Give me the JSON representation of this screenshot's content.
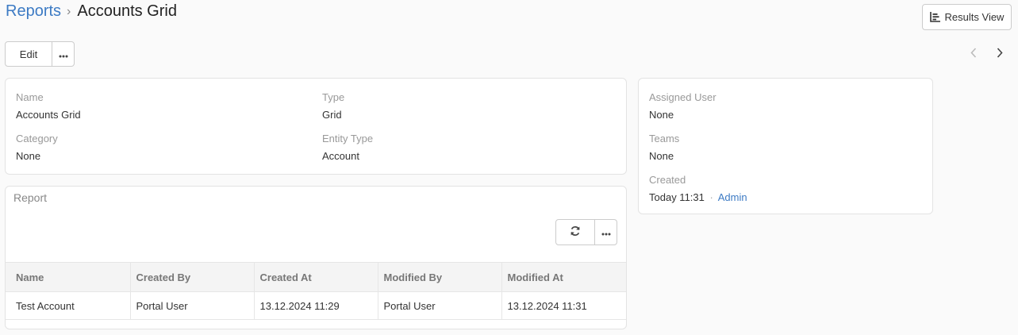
{
  "breadcrumb": {
    "parent": "Reports",
    "separator": "›",
    "current": "Accounts Grid"
  },
  "header": {
    "results_view_label": "Results View",
    "results_view_icon": "chart-icon"
  },
  "actions": {
    "edit_label": "Edit",
    "more_icon": "ellipsis-icon"
  },
  "navigation": {
    "prev_icon": "chevron-left-icon",
    "next_icon": "chevron-right-icon"
  },
  "details": {
    "name_label": "Name",
    "name_value": "Accounts Grid",
    "type_label": "Type",
    "type_value": "Grid",
    "category_label": "Category",
    "category_value": "None",
    "entity_type_label": "Entity Type",
    "entity_type_value": "Account"
  },
  "side": {
    "assigned_user_label": "Assigned User",
    "assigned_user_value": "None",
    "teams_label": "Teams",
    "teams_value": "None",
    "created_label": "Created",
    "created_time": "Today 11:31",
    "created_sep": "·",
    "created_by": "Admin"
  },
  "report": {
    "title": "Report",
    "refresh_icon": "refresh-icon",
    "columns": [
      "Name",
      "Created By",
      "Created At",
      "Modified By",
      "Modified At"
    ],
    "rows": [
      [
        "Test Account",
        "Portal User",
        "13.12.2024 11:29",
        "Portal User",
        "13.12.2024 11:31"
      ]
    ]
  },
  "colors": {
    "link": "#3d7bc4",
    "label": "#999999",
    "border": "#e3e3e3"
  }
}
